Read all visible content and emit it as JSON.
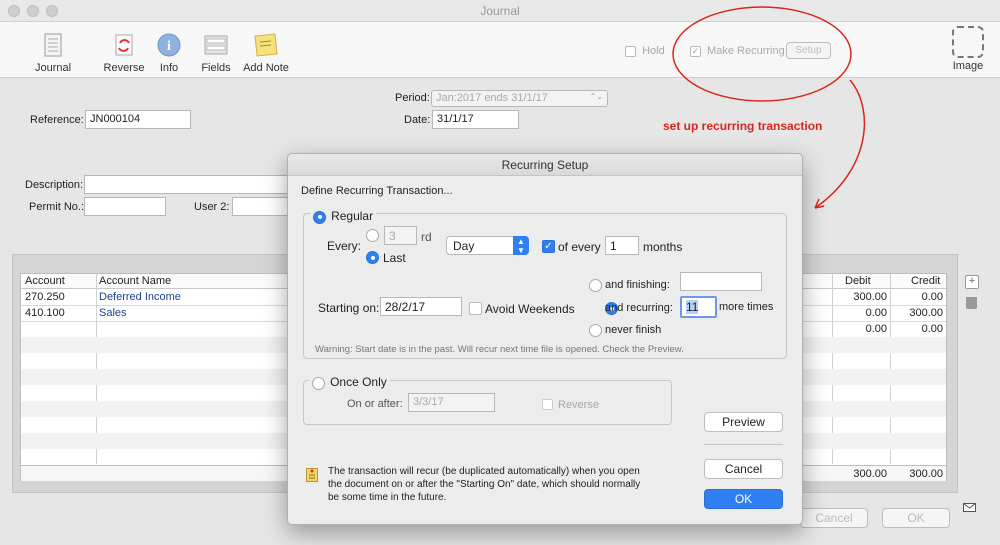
{
  "window": {
    "title": "Journal"
  },
  "toolbar": {
    "journal_label": "Journal",
    "reverse_label": "Reverse",
    "info_label": "Info",
    "fields_label": "Fields",
    "add_note_label": "Add Note",
    "hold_label": "Hold",
    "hold_checked": false,
    "make_recurring_label": "Make Recurring",
    "make_recurring_checked": true,
    "setup_label": "Setup",
    "image_label": "Image"
  },
  "annotation": {
    "text": "set up recurring transaction",
    "color": "#d9261c"
  },
  "form": {
    "period_label": "Period:",
    "period_value": "Jan:2017 ends 31/1/17",
    "reference_label": "Reference:",
    "reference_value": "JN000104",
    "date_label": "Date:",
    "date_value": "31/1/17",
    "description_label": "Description:",
    "description_value": "",
    "permit_label": "Permit No.:",
    "permit_value": "",
    "user2_label": "User 2:",
    "user2_value": ""
  },
  "table": {
    "headers": {
      "account": "Account",
      "account_name": "Account Name",
      "debit": "Debit",
      "credit": "Credit"
    },
    "rows": [
      {
        "account": "270.250",
        "name": "Deferred Income",
        "debit": "300.00",
        "credit": "0.00"
      },
      {
        "account": "410.100",
        "name": "Sales",
        "debit": "0.00",
        "credit": "300.00"
      },
      {
        "account": "",
        "name": "",
        "debit": "0.00",
        "credit": "0.00"
      }
    ],
    "totals": {
      "debit": "300.00",
      "credit": "300.00"
    }
  },
  "footer": {
    "cancel_label": "Cancel",
    "ok_label": "OK"
  },
  "dialog": {
    "title": "Recurring Setup",
    "heading": "Define Recurring Transaction...",
    "regular_label": "Regular",
    "every_label": "Every:",
    "every_value": "3",
    "ordinal_suffix": "rd",
    "last_label": "Last",
    "unit_value": "Day",
    "of_every_label": "of every",
    "of_every_value": "1",
    "months_label": "months",
    "starting_on_label": "Starting on:",
    "starting_on_value": "28/2/17",
    "avoid_weekends_label": "Avoid Weekends",
    "and_finishing_label": "and finishing:",
    "and_finishing_value": "",
    "and_recurring_label": "and recurring:",
    "recurring_count": "11",
    "more_times_label": "more times",
    "never_finish_label": "never finish",
    "warning": "Warning: Start date is in the past. Will recur next time file is opened. Check the Preview.",
    "once_only_label": "Once Only",
    "on_or_after_label": "On or after:",
    "on_or_after_value": "3/3/17",
    "reverse_label": "Reverse",
    "preview_label": "Preview",
    "cancel_label": "Cancel",
    "ok_label": "OK",
    "note": "The transaction will recur (be duplicated automatically) when you open the document on or after the \"Starting On\" date, which should normally be some time in the future."
  }
}
